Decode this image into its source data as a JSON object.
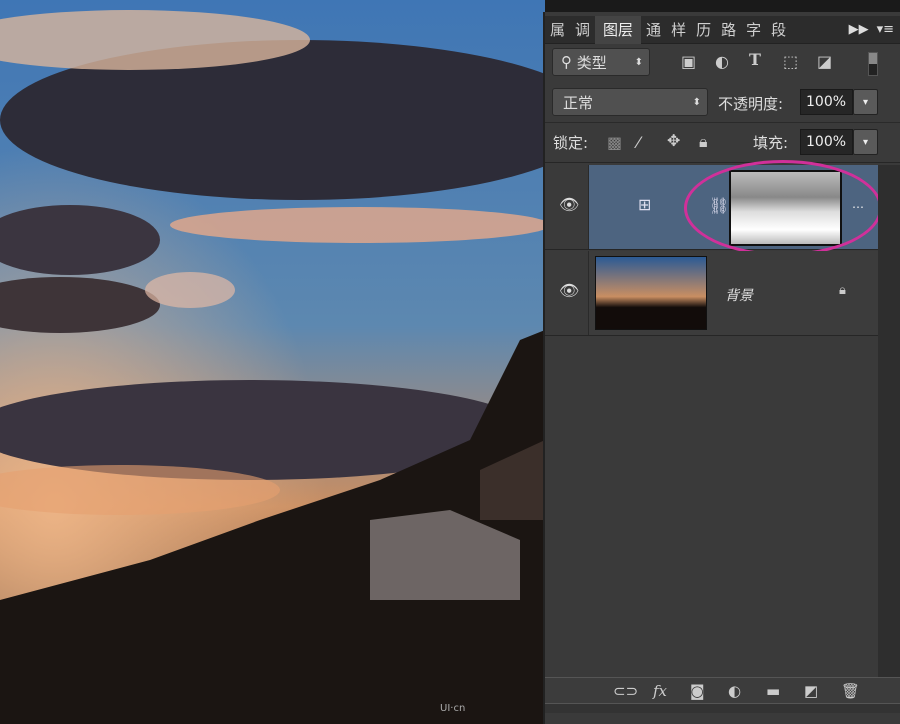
{
  "panel": {
    "tabs": [
      "属",
      "调",
      "图层",
      "通",
      "样",
      "历",
      "路",
      "字",
      "段"
    ],
    "active_tab": "图层",
    "menu_icons": [
      "fast-forward-icon",
      "panel-menu-icon"
    ],
    "filter": {
      "kind": "类型",
      "icons": [
        "image-filter-icon",
        "adjustment-filter-icon",
        "type-filter-icon",
        "shape-filter-icon",
        "smart-object-filter-icon"
      ]
    },
    "blend_mode": "正常",
    "opacity_label": "不透明度:",
    "opacity": "100%",
    "lock_label": "锁定:",
    "fill_label": "填充:",
    "fill": "100%",
    "layers": [
      {
        "name": "",
        "type": "curves-adjustment",
        "selected": true,
        "visible": true,
        "highlight_color": "#d0309a"
      },
      {
        "name": "背景",
        "type": "background",
        "locked": true,
        "visible": true
      }
    ],
    "bottom_icons": [
      "link-icon",
      "fx-icon",
      "mask-icon",
      "adjustment-icon",
      "folder-icon",
      "new-layer-icon",
      "trash-icon"
    ],
    "fx_label": "fx"
  },
  "watermark": "UI·cn",
  "colors": {
    "selected_layer": "#4d6480",
    "panel": "#3a3a3a",
    "highlight": "#d0309a"
  }
}
